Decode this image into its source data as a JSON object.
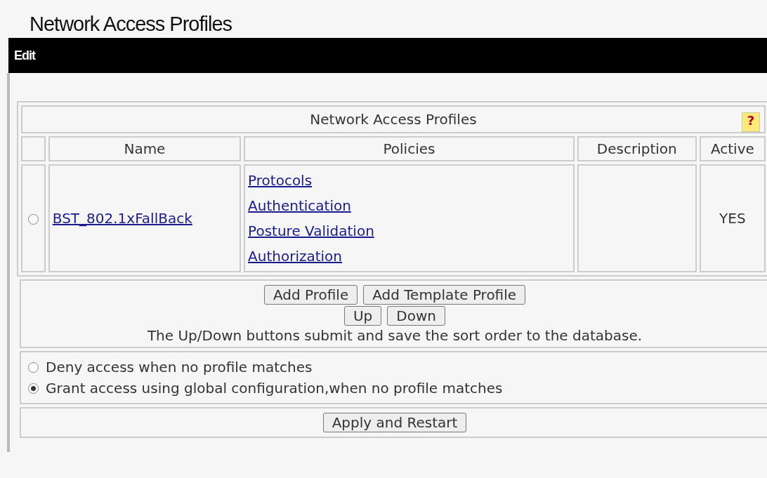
{
  "page_title": "Network Access Profiles",
  "menu_bar": {
    "label": "Edit"
  },
  "table": {
    "title": "Network Access Profiles",
    "help": "?",
    "columns": [
      "Name",
      "Policies",
      "Description",
      "Active"
    ],
    "rows": [
      {
        "selected": false,
        "name": "BST_802.1xFallBack",
        "policies": [
          "Protocols",
          "Authentication",
          "Posture Validation",
          "Authorization"
        ],
        "active": "YES"
      }
    ]
  },
  "buttons": [
    "Add Profile",
    "Add Template Profile"
  ],
  "order_buttons": [
    "Up",
    "Down"
  ],
  "note": "The Up/Down buttons submit and save the sort order to the database.",
  "options": [
    {
      "label": "Deny access when no profile matches",
      "selected": false
    },
    {
      "label": "Grant access using global configuration,when no profile matches",
      "selected": true
    }
  ],
  "apply_button": "Apply and Restart"
}
